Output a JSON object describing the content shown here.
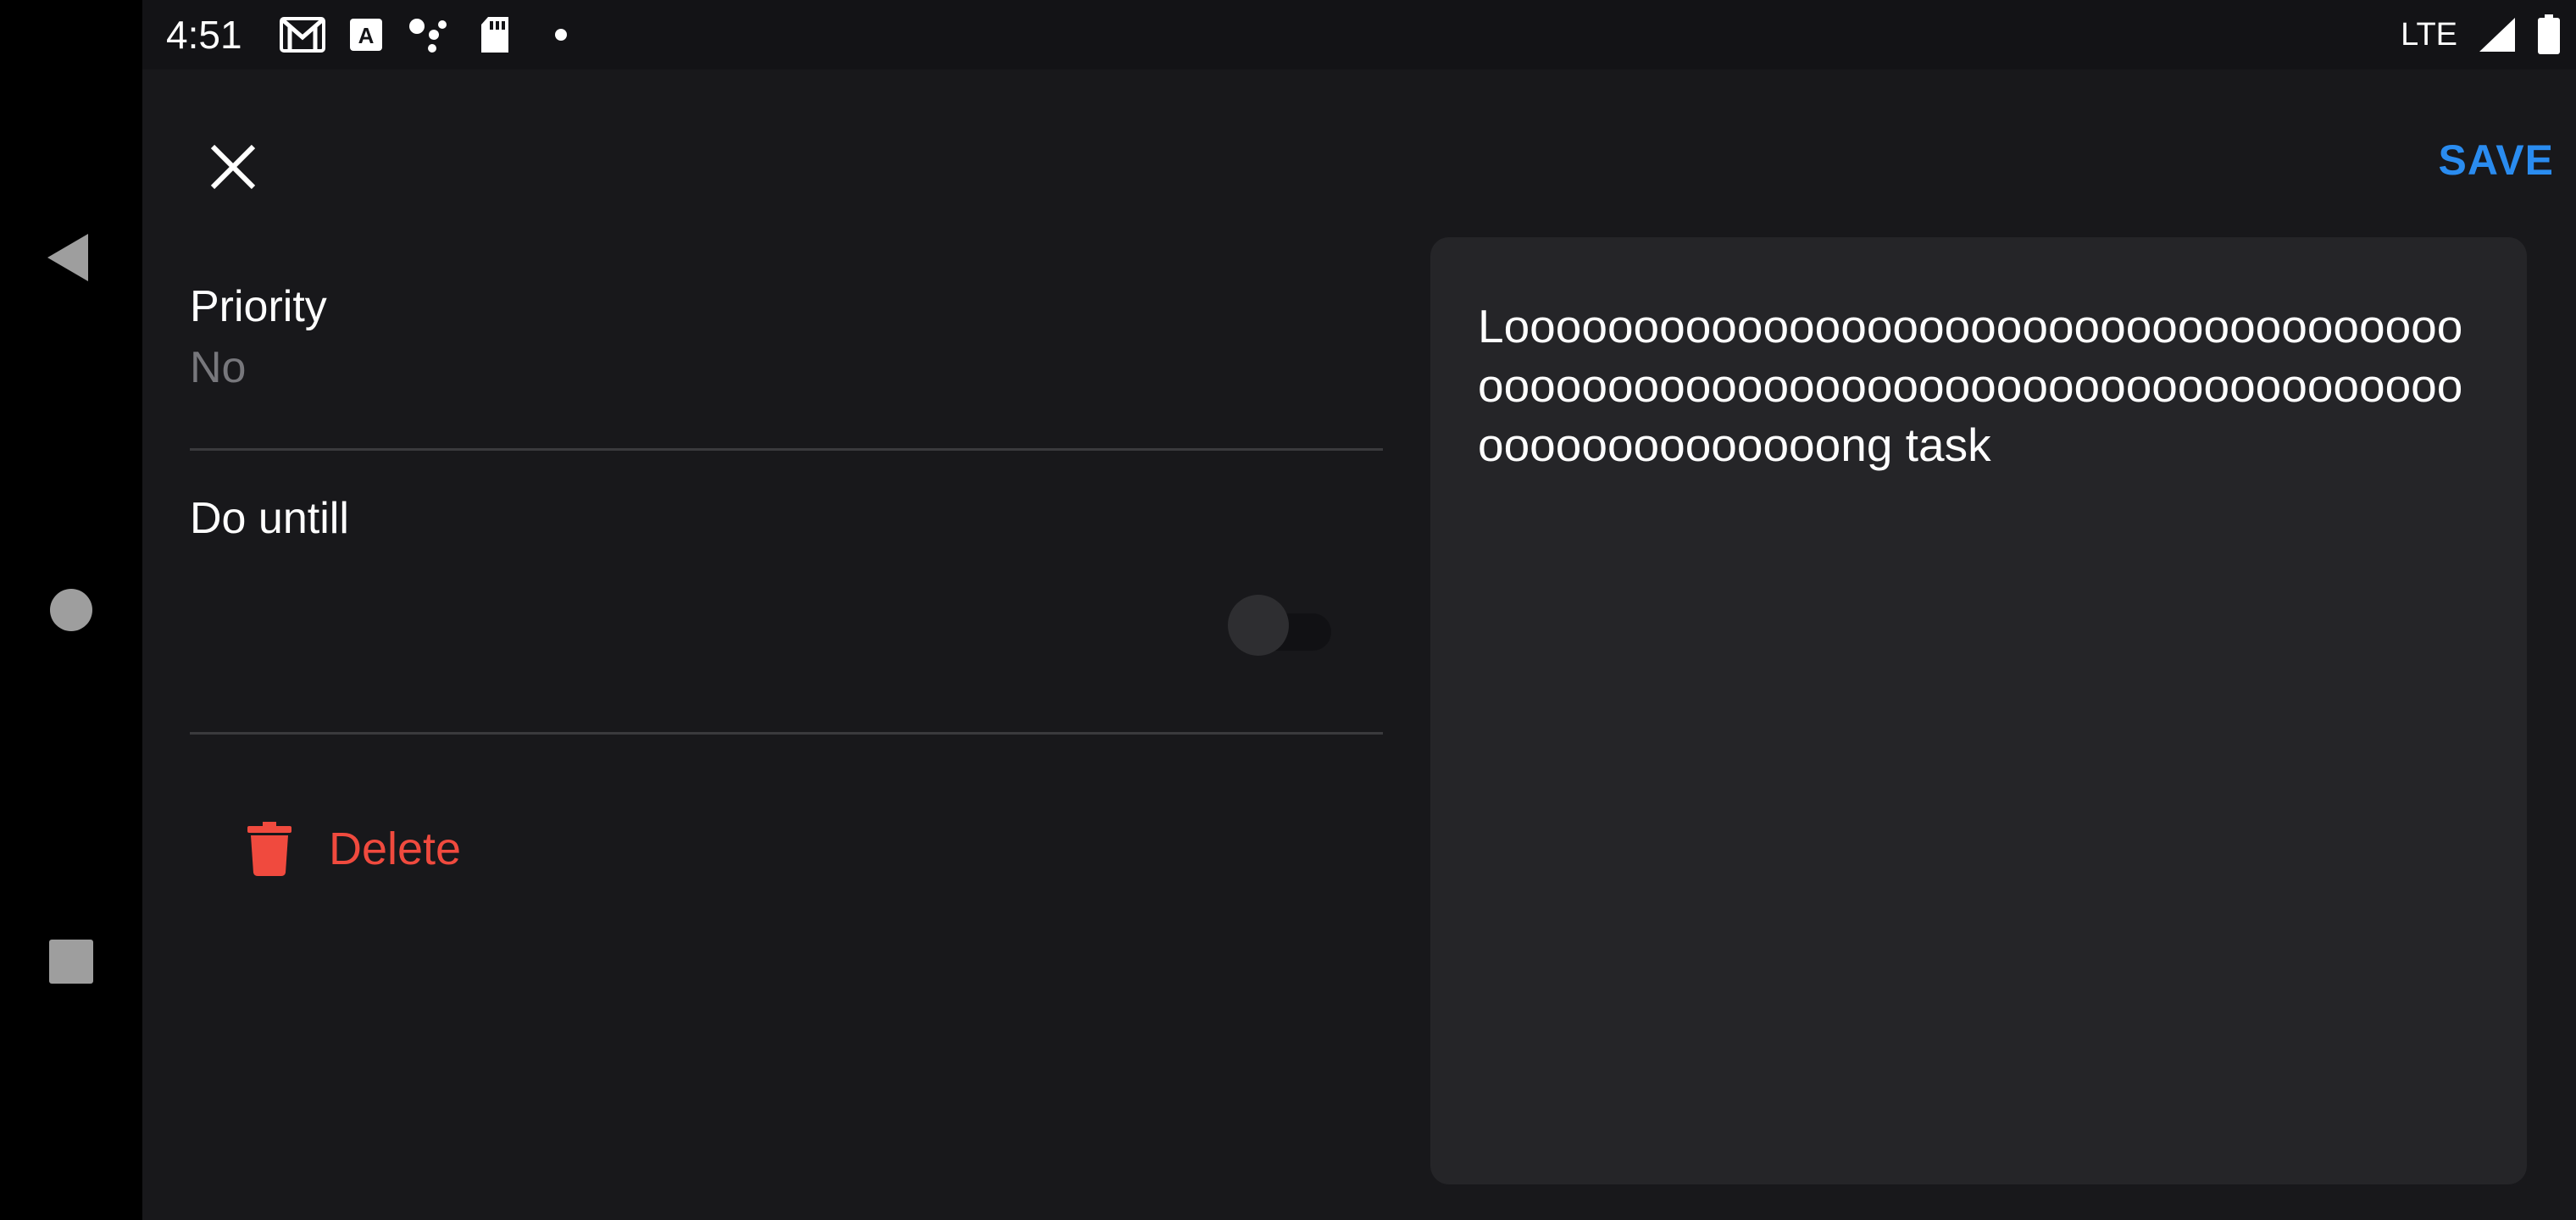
{
  "status_bar": {
    "time": "4:51",
    "icons": [
      "gmail-icon",
      "translate-a-icon",
      "assistant-dots-icon",
      "sd-card-icon",
      "notification-dot-icon"
    ],
    "network": "LTE",
    "signal_icon": "signal-icon",
    "battery_icon": "battery-icon"
  },
  "nav_bar": {
    "back_icon": "back-triangle-icon",
    "home_icon": "home-circle-icon",
    "recents_icon": "recents-square-icon"
  },
  "toolbar": {
    "close_icon": "close-icon",
    "save_label": "SAVE"
  },
  "form": {
    "priority_label": "Priority",
    "priority_value": "No",
    "do_until_label": "Do untill",
    "do_until_enabled": false,
    "delete_label": "Delete"
  },
  "task": {
    "text": "Looooooooooooooooooooooooooooooooooooooooooooooooooooooooooooooooooooooooooooooooooooooooong task"
  },
  "colors": {
    "accent": "#2a8cf0",
    "danger": "#f04a3e",
    "background": "#18181b",
    "card": "#252528"
  }
}
